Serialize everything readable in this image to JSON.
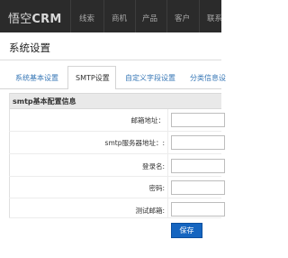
{
  "app": {
    "brand_main": "悟空",
    "brand_crm": "CRM"
  },
  "nav": {
    "items": [
      "线索",
      "商机",
      "产品",
      "客户",
      "联系"
    ]
  },
  "page": {
    "title": "系统设置"
  },
  "tabs": [
    {
      "label": "系统基本设置",
      "active": false
    },
    {
      "label": "SMTP设置",
      "active": true
    },
    {
      "label": "自定义字段设置",
      "active": false
    },
    {
      "label": "分类信息设",
      "active": false
    }
  ],
  "panel": {
    "header": "smtp基本配置信息",
    "fields": [
      {
        "label": "邮箱地址：",
        "value": ""
      },
      {
        "label": "smtp服务器地址：:",
        "value": ""
      },
      {
        "label": "登录名:",
        "value": ""
      },
      {
        "label": "密码:",
        "value": ""
      },
      {
        "label": "测试邮箱:",
        "value": ""
      }
    ],
    "save_label": "保存"
  },
  "colors": {
    "topbar": "#2b2b2b",
    "link": "#3777b6",
    "button": "#1565c0"
  }
}
